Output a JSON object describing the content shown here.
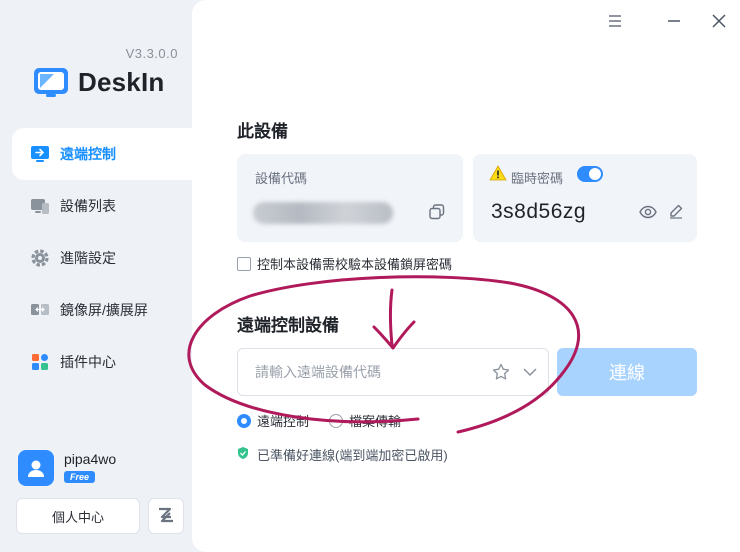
{
  "app": {
    "version": "V3.3.0.0",
    "name": "DeskIn"
  },
  "sidebar": {
    "items": [
      {
        "label": "遠端控制",
        "icon": "remote-control-icon",
        "active": true
      },
      {
        "label": "設備列表",
        "icon": "device-list-icon",
        "active": false
      },
      {
        "label": "進階設定",
        "icon": "gear-icon",
        "active": false
      },
      {
        "label": "鏡像屏/擴展屏",
        "icon": "mirror-screen-icon",
        "active": false
      },
      {
        "label": "插件中心",
        "icon": "plugin-grid-icon",
        "active": false
      }
    ]
  },
  "user": {
    "name": "pipa4wo",
    "plan": "Free",
    "personal_center": "個人中心"
  },
  "this_device": {
    "title": "此設備",
    "code_label": "設備代碼",
    "temp_pwd_label": "臨時密碼",
    "temp_pwd_value": "3s8d56zg",
    "temp_pwd_enabled": true,
    "lock_check_label": "控制本設備需校驗本設備鎖屏密碼"
  },
  "remote": {
    "title": "遠端控制設備",
    "input_placeholder": "請輸入遠端設備代碼",
    "connect_label": "連線",
    "modes": [
      {
        "label": "遠端控制",
        "selected": true
      },
      {
        "label": "檔案傳輸",
        "selected": false
      }
    ],
    "status": "已準備好連線(端到端加密已啟用)"
  },
  "colors": {
    "accent": "#2f8cff",
    "annotation": "#b0195a",
    "connect_disabled": "#a9d3ff"
  }
}
